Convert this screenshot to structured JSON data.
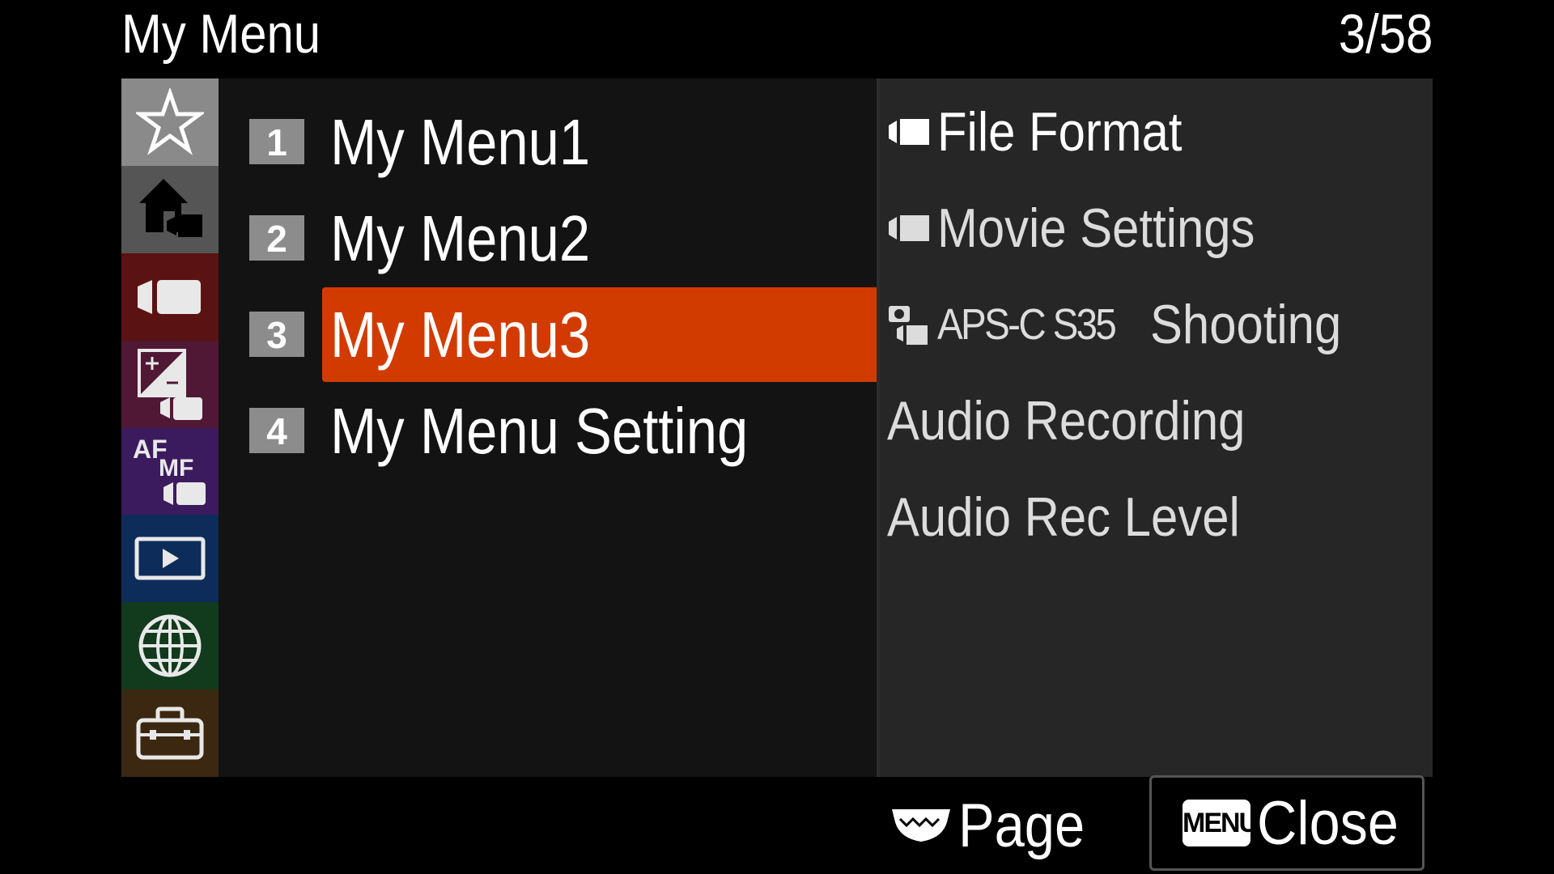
{
  "header": {
    "title": "My Menu",
    "page_indicator": "3/58"
  },
  "sidebar": {
    "tabs": [
      {
        "icon": "star-icon",
        "color": "#8a8a8a"
      },
      {
        "icon": "home-movie-icon",
        "color": "#555555"
      },
      {
        "icon": "movie-camera-icon",
        "color": "#5b1212"
      },
      {
        "icon": "exposure-movie-icon",
        "color": "#511835"
      },
      {
        "icon": "af-mf-movie-icon",
        "label": "AF",
        "sublabel": "MF",
        "color": "#3c1a5e"
      },
      {
        "icon": "playback-icon",
        "color": "#0d2c5a"
      },
      {
        "icon": "network-globe-icon",
        "color": "#123a1d"
      },
      {
        "icon": "toolbox-icon",
        "color": "#3c2810"
      }
    ]
  },
  "menu": {
    "items": [
      {
        "number": "1",
        "label": "My Menu1"
      },
      {
        "number": "2",
        "label": "My Menu2"
      },
      {
        "number": "3",
        "label": "My Menu3"
      },
      {
        "number": "4",
        "label": "My Menu Setting"
      }
    ],
    "selected_color": "#d23b00"
  },
  "submenu": {
    "items": [
      {
        "icon": "movie-icon",
        "label": "File Format"
      },
      {
        "icon": "movie-icon",
        "label": "Movie Settings"
      },
      {
        "icon": "photo-movie-icon",
        "prefix": "APS-C S35",
        "label": "Shooting"
      },
      {
        "icon": "",
        "label": "Audio Recording"
      },
      {
        "icon": "",
        "label": "Audio Rec Level"
      }
    ]
  },
  "footer": {
    "page_label": "Page",
    "menu_key": "MENU",
    "close_label": "Close"
  }
}
